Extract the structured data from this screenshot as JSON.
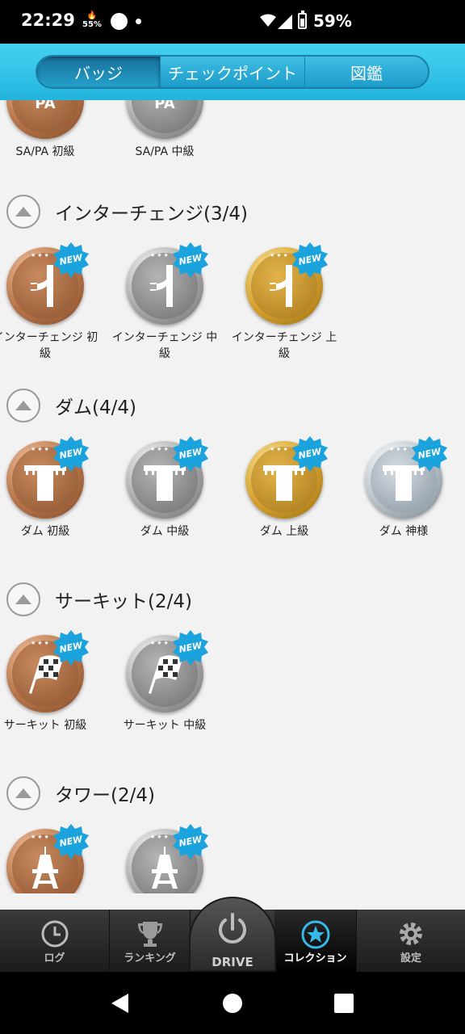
{
  "status_bar": {
    "time": "22:29",
    "mini_top": "🔥",
    "mini_bottom": "55%",
    "battery_percent": "59%"
  },
  "top_tabs": [
    {
      "label": "バッジ",
      "active": true
    },
    {
      "label": "チェックポイント",
      "active": false
    },
    {
      "label": "図鑑",
      "active": false
    }
  ],
  "sapa_row": [
    {
      "label": "SA/PA 初級",
      "tier": "bronze"
    },
    {
      "label": "SA/PA 中級",
      "tier": "silver"
    }
  ],
  "sections": [
    {
      "title": "インターチェンジ(3/4)",
      "icon": "interchange-icon",
      "badges": [
        {
          "label": "インターチェンジ 初級",
          "tier": "bronze",
          "new": "NEW"
        },
        {
          "label": "インターチェンジ 中級",
          "tier": "silver",
          "new": "NEW"
        },
        {
          "label": "インターチェンジ 上級",
          "tier": "gold",
          "new": "NEW"
        }
      ]
    },
    {
      "title": "ダム(4/4)",
      "icon": "dam-icon",
      "badges": [
        {
          "label": "ダム 初級",
          "tier": "bronze",
          "new": "NEW"
        },
        {
          "label": "ダム 中級",
          "tier": "silver",
          "new": "NEW"
        },
        {
          "label": "ダム 上級",
          "tier": "gold",
          "new": "NEW"
        },
        {
          "label": "ダム 神様",
          "tier": "platinum",
          "new": "NEW"
        }
      ]
    },
    {
      "title": "サーキット(2/4)",
      "icon": "checkered-flag-icon",
      "badges": [
        {
          "label": "サーキット 初級",
          "tier": "bronze",
          "new": "NEW"
        },
        {
          "label": "サーキット 中級",
          "tier": "silver",
          "new": "NEW"
        }
      ]
    },
    {
      "title": "タワー(2/4)",
      "icon": "tower-icon",
      "badges": [
        {
          "label": "",
          "tier": "bronze",
          "new": "NEW"
        },
        {
          "label": "",
          "tier": "silver",
          "new": "NEW"
        }
      ]
    }
  ],
  "bottom_nav": {
    "log": "ログ",
    "ranking": "ランキング",
    "drive": "DRIVE",
    "collection": "コレクション",
    "settings": "設定"
  }
}
